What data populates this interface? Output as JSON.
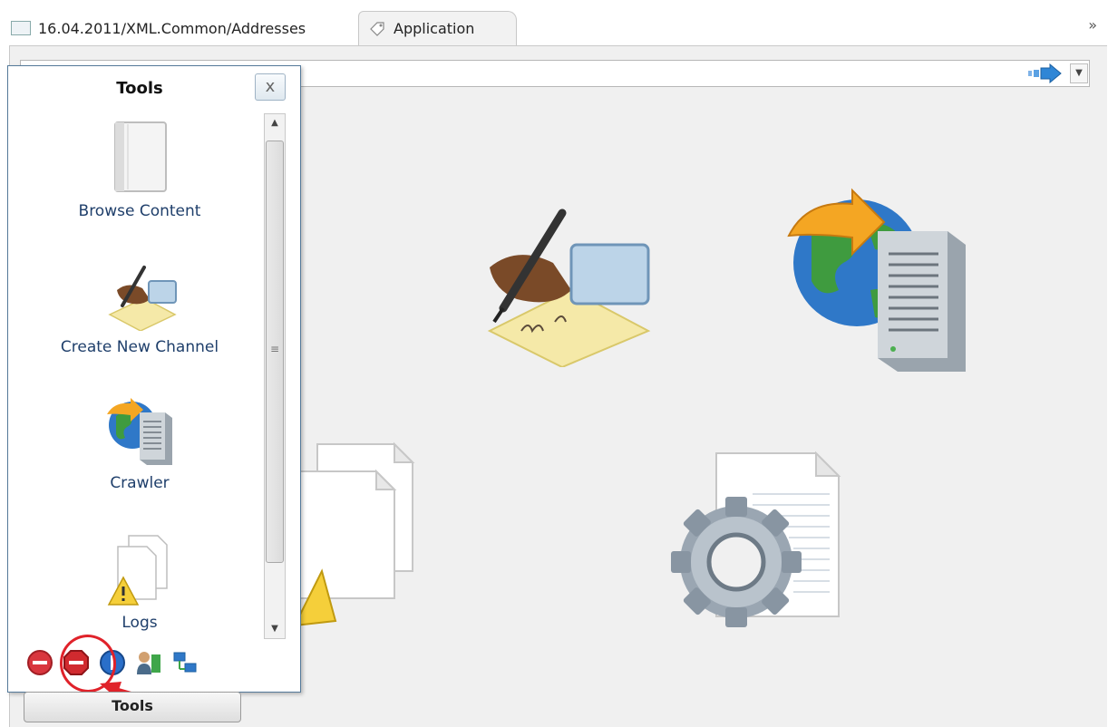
{
  "tabs": [
    {
      "label": "16.04.2011/XML.Common/Addresses",
      "icon": "document-icon"
    },
    {
      "label": "Application",
      "icon": "tag-icon",
      "active": true
    }
  ],
  "overflow_glyph": "»",
  "tools_panel": {
    "title": "Tools",
    "close_glyph": "x",
    "items": [
      {
        "label": "Browse Content",
        "icon": "book-icon"
      },
      {
        "label": "Create New Channel",
        "icon": "pen-signature-icon"
      },
      {
        "label": "Crawler",
        "icon": "globe-server-icon"
      },
      {
        "label": "Logs",
        "icon": "logs-warning-icon"
      }
    ],
    "toolbar_icons": [
      "power-icon",
      "stop-icon",
      "info-icon",
      "user-icon",
      "network-icon"
    ],
    "dock_button_label": "Tools"
  },
  "colors": {
    "accent_red": "#e0222a",
    "link_blue": "#1f3f6b"
  }
}
